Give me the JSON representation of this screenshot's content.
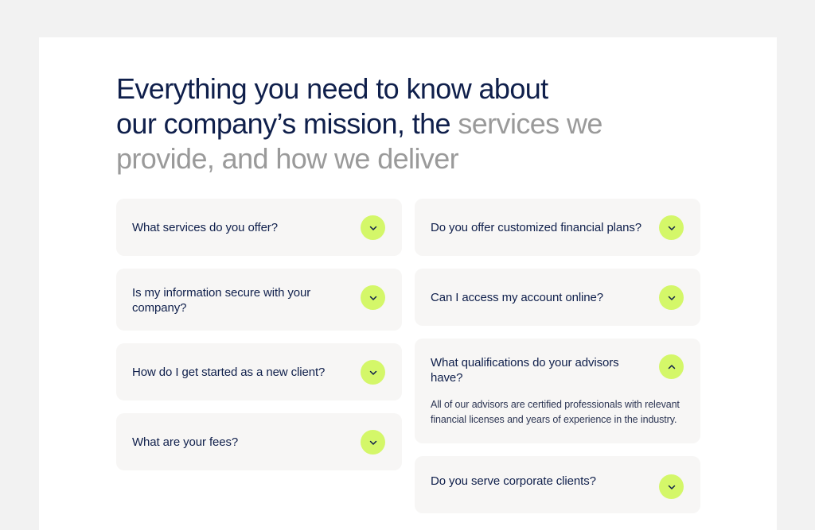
{
  "heading": {
    "line1": "Everything you need to know about",
    "line2_dark": "our company’s mission, the ",
    "line2_muted": "services we",
    "line3_muted": "provide, and how we deliver"
  },
  "faq": {
    "left": [
      {
        "question": "What services do you offer?",
        "expanded": false
      },
      {
        "question": "Is my information secure with your company?",
        "expanded": false
      },
      {
        "question": "How do I get started as a new client?",
        "expanded": false
      },
      {
        "question": "What are your fees?",
        "expanded": false
      }
    ],
    "right": [
      {
        "question": "Do you offer customized financial plans?",
        "expanded": false
      },
      {
        "question": "Can I access my account online?",
        "expanded": false
      },
      {
        "question": "What qualifications do your advisors have?",
        "expanded": true,
        "answer": "All of our advisors are certified professionals with relevant financial licenses and years of experience in the industry."
      },
      {
        "question": "Do you serve corporate clients?",
        "expanded": false
      }
    ]
  },
  "colors": {
    "heading": "#0f1f4b",
    "muted": "#9a9a9a",
    "card_bg": "#f7f6f5",
    "accent": "#d4f769"
  },
  "icons": {
    "collapsed": "chevron-down-icon",
    "expanded": "chevron-up-icon"
  }
}
